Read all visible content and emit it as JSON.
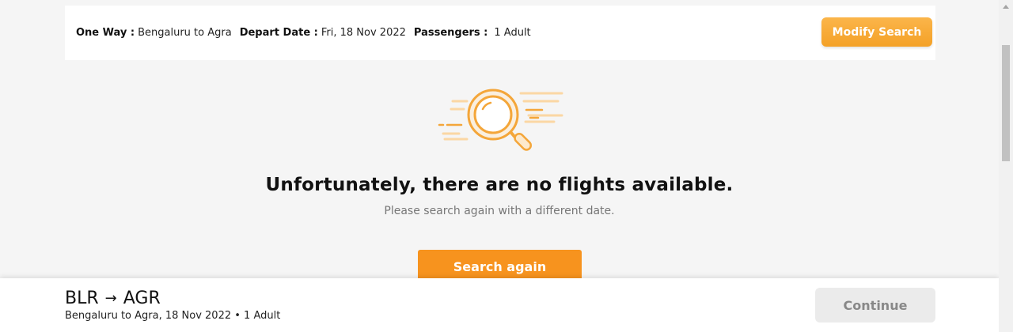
{
  "summary": {
    "trip_type_label": "One Way :",
    "route": "Bengaluru to Agra",
    "depart_label": "Depart Date :",
    "depart_value": "Fri, 18 Nov 2022",
    "passengers_label": "Passengers :",
    "passengers_value": "1 Adult",
    "modify_label": "Modify Search"
  },
  "empty_state": {
    "illustration_icon": "magnifier-icon",
    "title": "Unfortunately, there are no flights available.",
    "subtitle": "Please search again with a different date.",
    "button_label": "Search again"
  },
  "bottom_bar": {
    "origin": "BLR",
    "arrow": "→",
    "destination": "AGR",
    "detail": "Bengaluru to Agra, 18 Nov 2022 • 1 Adult",
    "continue_label": "Continue"
  },
  "colors": {
    "accent": "#f7931e",
    "modify_button": "#f6a935",
    "illustration": "#f4a63a",
    "disabled_button": "#ebebeb"
  }
}
